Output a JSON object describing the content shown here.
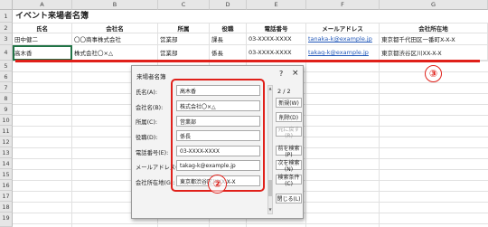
{
  "sheet": {
    "columns": [
      "A",
      "B",
      "C",
      "D",
      "E",
      "F",
      "G"
    ],
    "rows": [
      "1",
      "2",
      "3",
      "4",
      "5",
      "6",
      "7",
      "8",
      "9",
      "10",
      "11",
      "12",
      "13",
      "14",
      "15",
      "16",
      "17",
      "18",
      "19"
    ],
    "title": "イベント来場者名簿",
    "headers": [
      "氏名",
      "会社名",
      "所属",
      "役職",
      "電話番号",
      "メールアドレス",
      "会社所在地"
    ],
    "data": [
      [
        "田中健二",
        "〇〇商事株式会社",
        "営業部",
        "課長",
        "03-XXXX-XXXX",
        "tanaka-k@example.jp",
        "東京都千代田区一番町X-X-X"
      ],
      [
        "高木香",
        "株式会社〇×△",
        "営業部",
        "係長",
        "03-XXXX-XXXX",
        "takag-k@example.jp",
        "東京都渋谷区川XX-X-X"
      ]
    ]
  },
  "dialog": {
    "title": "来場者名簿",
    "help": "?",
    "close": "×",
    "record_counter": "2 / 2",
    "fields": [
      {
        "label": "氏名(A):",
        "value": "高木香"
      },
      {
        "label": "会社名(B):",
        "value": "株式会社〇×△"
      },
      {
        "label": "所属(C):",
        "value": "営業部"
      },
      {
        "label": "役職(D):",
        "value": "係長"
      },
      {
        "label": "電話番号(E):",
        "value": "03-XXXX-XXXX"
      },
      {
        "label": "メールアドレス(F):",
        "value": "takag-k@example.jp"
      },
      {
        "label": "会社所在地(G):",
        "value": "東京都渋谷区川XX-X-X"
      }
    ],
    "buttons": {
      "new": "新規(W)",
      "delete": "削除(D)",
      "restore": "元に戻す(R)",
      "prev": "前を検索(P)",
      "next": "次を検索(N)",
      "criteria": "検索条件(C)",
      "close": "閉じる(L)"
    }
  },
  "annotations": {
    "two": "②",
    "three": "③",
    "accent_color": "#e0201a"
  }
}
